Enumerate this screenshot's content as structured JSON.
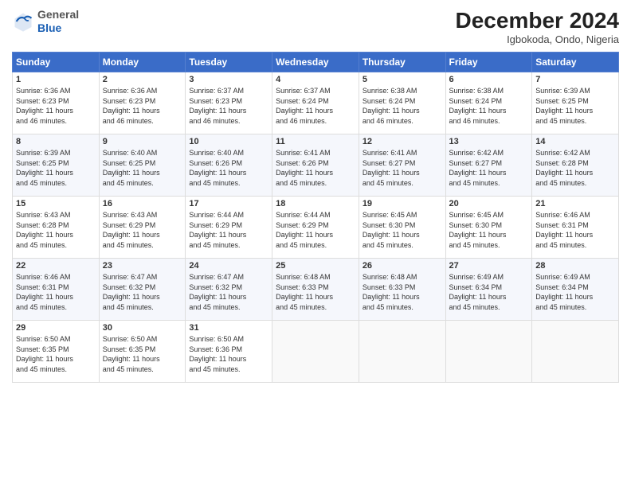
{
  "header": {
    "logo_line1": "General",
    "logo_line2": "Blue",
    "month_year": "December 2024",
    "location": "Igbokoda, Ondo, Nigeria"
  },
  "days_of_week": [
    "Sunday",
    "Monday",
    "Tuesday",
    "Wednesday",
    "Thursday",
    "Friday",
    "Saturday"
  ],
  "weeks": [
    [
      {
        "day": "1",
        "info": "Sunrise: 6:36 AM\nSunset: 6:23 PM\nDaylight: 11 hours\nand 46 minutes."
      },
      {
        "day": "2",
        "info": "Sunrise: 6:36 AM\nSunset: 6:23 PM\nDaylight: 11 hours\nand 46 minutes."
      },
      {
        "day": "3",
        "info": "Sunrise: 6:37 AM\nSunset: 6:23 PM\nDaylight: 11 hours\nand 46 minutes."
      },
      {
        "day": "4",
        "info": "Sunrise: 6:37 AM\nSunset: 6:24 PM\nDaylight: 11 hours\nand 46 minutes."
      },
      {
        "day": "5",
        "info": "Sunrise: 6:38 AM\nSunset: 6:24 PM\nDaylight: 11 hours\nand 46 minutes."
      },
      {
        "day": "6",
        "info": "Sunrise: 6:38 AM\nSunset: 6:24 PM\nDaylight: 11 hours\nand 46 minutes."
      },
      {
        "day": "7",
        "info": "Sunrise: 6:39 AM\nSunset: 6:25 PM\nDaylight: 11 hours\nand 45 minutes."
      }
    ],
    [
      {
        "day": "8",
        "info": "Sunrise: 6:39 AM\nSunset: 6:25 PM\nDaylight: 11 hours\nand 45 minutes."
      },
      {
        "day": "9",
        "info": "Sunrise: 6:40 AM\nSunset: 6:25 PM\nDaylight: 11 hours\nand 45 minutes."
      },
      {
        "day": "10",
        "info": "Sunrise: 6:40 AM\nSunset: 6:26 PM\nDaylight: 11 hours\nand 45 minutes."
      },
      {
        "day": "11",
        "info": "Sunrise: 6:41 AM\nSunset: 6:26 PM\nDaylight: 11 hours\nand 45 minutes."
      },
      {
        "day": "12",
        "info": "Sunrise: 6:41 AM\nSunset: 6:27 PM\nDaylight: 11 hours\nand 45 minutes."
      },
      {
        "day": "13",
        "info": "Sunrise: 6:42 AM\nSunset: 6:27 PM\nDaylight: 11 hours\nand 45 minutes."
      },
      {
        "day": "14",
        "info": "Sunrise: 6:42 AM\nSunset: 6:28 PM\nDaylight: 11 hours\nand 45 minutes."
      }
    ],
    [
      {
        "day": "15",
        "info": "Sunrise: 6:43 AM\nSunset: 6:28 PM\nDaylight: 11 hours\nand 45 minutes."
      },
      {
        "day": "16",
        "info": "Sunrise: 6:43 AM\nSunset: 6:29 PM\nDaylight: 11 hours\nand 45 minutes."
      },
      {
        "day": "17",
        "info": "Sunrise: 6:44 AM\nSunset: 6:29 PM\nDaylight: 11 hours\nand 45 minutes."
      },
      {
        "day": "18",
        "info": "Sunrise: 6:44 AM\nSunset: 6:29 PM\nDaylight: 11 hours\nand 45 minutes."
      },
      {
        "day": "19",
        "info": "Sunrise: 6:45 AM\nSunset: 6:30 PM\nDaylight: 11 hours\nand 45 minutes."
      },
      {
        "day": "20",
        "info": "Sunrise: 6:45 AM\nSunset: 6:30 PM\nDaylight: 11 hours\nand 45 minutes."
      },
      {
        "day": "21",
        "info": "Sunrise: 6:46 AM\nSunset: 6:31 PM\nDaylight: 11 hours\nand 45 minutes."
      }
    ],
    [
      {
        "day": "22",
        "info": "Sunrise: 6:46 AM\nSunset: 6:31 PM\nDaylight: 11 hours\nand 45 minutes."
      },
      {
        "day": "23",
        "info": "Sunrise: 6:47 AM\nSunset: 6:32 PM\nDaylight: 11 hours\nand 45 minutes."
      },
      {
        "day": "24",
        "info": "Sunrise: 6:47 AM\nSunset: 6:32 PM\nDaylight: 11 hours\nand 45 minutes."
      },
      {
        "day": "25",
        "info": "Sunrise: 6:48 AM\nSunset: 6:33 PM\nDaylight: 11 hours\nand 45 minutes."
      },
      {
        "day": "26",
        "info": "Sunrise: 6:48 AM\nSunset: 6:33 PM\nDaylight: 11 hours\nand 45 minutes."
      },
      {
        "day": "27",
        "info": "Sunrise: 6:49 AM\nSunset: 6:34 PM\nDaylight: 11 hours\nand 45 minutes."
      },
      {
        "day": "28",
        "info": "Sunrise: 6:49 AM\nSunset: 6:34 PM\nDaylight: 11 hours\nand 45 minutes."
      }
    ],
    [
      {
        "day": "29",
        "info": "Sunrise: 6:50 AM\nSunset: 6:35 PM\nDaylight: 11 hours\nand 45 minutes."
      },
      {
        "day": "30",
        "info": "Sunrise: 6:50 AM\nSunset: 6:35 PM\nDaylight: 11 hours\nand 45 minutes."
      },
      {
        "day": "31",
        "info": "Sunrise: 6:50 AM\nSunset: 6:36 PM\nDaylight: 11 hours\nand 45 minutes."
      },
      {
        "day": "",
        "info": ""
      },
      {
        "day": "",
        "info": ""
      },
      {
        "day": "",
        "info": ""
      },
      {
        "day": "",
        "info": ""
      }
    ]
  ]
}
